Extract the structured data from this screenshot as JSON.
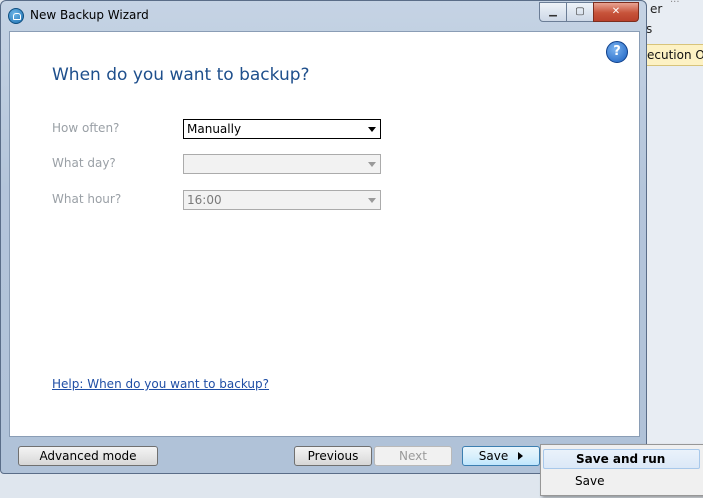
{
  "background_app": {
    "text1": "er",
    "text2": "s",
    "tab_label": "ecution Or",
    "faint": "..."
  },
  "window": {
    "title": "New Backup Wizard",
    "minimize_glyph": "▁",
    "maximize_glyph": "▢",
    "close_glyph": "✕"
  },
  "wizard": {
    "help_glyph": "?",
    "heading": "When do you want to backup?",
    "fields": [
      {
        "label": "How often?",
        "value": "Manually",
        "enabled": true
      },
      {
        "label": "What day?",
        "value": "",
        "enabled": false
      },
      {
        "label": "What hour?",
        "value": "16:00",
        "enabled": false
      }
    ],
    "help_link": "Help: When do you want to backup?"
  },
  "footer": {
    "advanced_mode": "Advanced mode",
    "previous": "Previous",
    "next": "Next",
    "save": "Save"
  },
  "save_menu": {
    "items": [
      "Save and run",
      "Save"
    ]
  }
}
